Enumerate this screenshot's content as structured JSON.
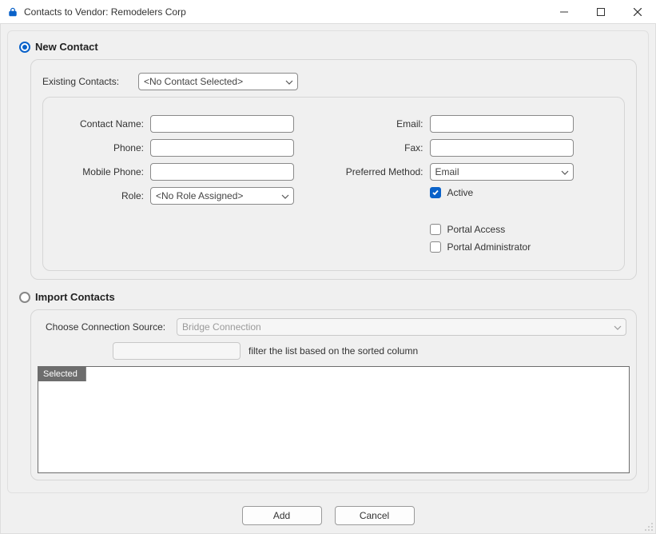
{
  "window": {
    "title": "Contacts to Vendor: Remodelers Corp"
  },
  "radios": {
    "new_contact": "New Contact",
    "import_contacts": "Import Contacts"
  },
  "existing": {
    "label": "Existing Contacts:",
    "selected": "<No Contact Selected>"
  },
  "fields": {
    "contact_name": {
      "label": "Contact Name:",
      "value": ""
    },
    "phone": {
      "label": "Phone:",
      "value": ""
    },
    "mobile_phone": {
      "label": "Mobile Phone:",
      "value": ""
    },
    "role": {
      "label": "Role:",
      "selected": "<No Role Assigned>"
    },
    "email": {
      "label": "Email:",
      "value": ""
    },
    "fax": {
      "label": "Fax:",
      "value": ""
    },
    "preferred_method": {
      "label": "Preferred Method:",
      "selected": "Email"
    }
  },
  "checks": {
    "active": {
      "label": "Active",
      "checked": true
    },
    "portal_access": {
      "label": "Portal Access",
      "checked": false
    },
    "portal_admin": {
      "label": "Portal Administrator",
      "checked": false
    }
  },
  "import": {
    "source_label": "Choose Connection Source:",
    "source_selected": "Bridge Connection",
    "filter_value": "",
    "filter_hint": "filter the list based on the sorted column",
    "grid_header": "Selected"
  },
  "buttons": {
    "add": "Add",
    "cancel": "Cancel"
  }
}
